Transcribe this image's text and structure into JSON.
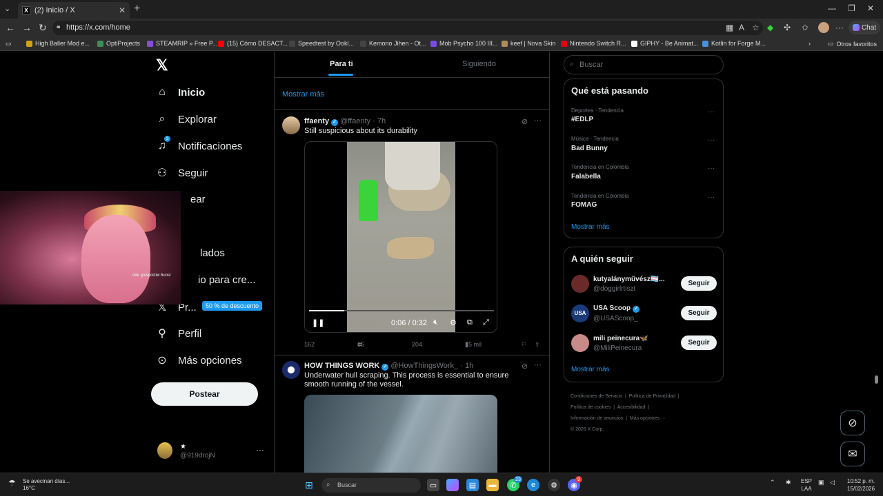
{
  "browser": {
    "tab_title": "(2) Inicio / X",
    "url": "https://x.com/home",
    "copilot_label": "Chat",
    "bookmarks": [
      {
        "label": "High Baller Mod e...",
        "color": "#d4a017"
      },
      {
        "label": "OptiProjects",
        "color": "#3a8f5a"
      },
      {
        "label": "STEAMRIP » Free P...",
        "color": "#8a4cd8"
      },
      {
        "label": "(15) Cómo DESACT...",
        "color": "#ff0000"
      },
      {
        "label": "Speedtest by Ookl...",
        "color": "#444444"
      },
      {
        "label": "Kemono Jihen - Ot...",
        "color": "#444444"
      },
      {
        "label": "Mob Psycho 100 III...",
        "color": "#7a4ce0"
      },
      {
        "label": "keef | Nova Skin",
        "color": "#b08a5a"
      },
      {
        "label": "Nintendo Switch R...",
        "color": "#e60012"
      },
      {
        "label": "GIPHY - Be Animat...",
        "color": "#ffffff"
      },
      {
        "label": "Kotlin for Forge M...",
        "color": "#4a8fd8"
      }
    ],
    "other_favorites": "Otros favoritos"
  },
  "nav": {
    "items": [
      {
        "label": "Inicio",
        "icon": "home-icon"
      },
      {
        "label": "Explorar",
        "icon": "search-icon"
      },
      {
        "label": "Notificaciones",
        "icon": "bell-icon",
        "count": "2"
      },
      {
        "label": "Seguir",
        "icon": "person-add-icon"
      },
      {
        "label": "ear",
        "icon": "chat-icon"
      },
      {
        "label": "lados",
        "icon": "bookmark-icon"
      },
      {
        "label": "io para cre...",
        "icon": "lightning-icon"
      },
      {
        "label": "Pr...",
        "icon": "x-icon"
      },
      {
        "label": "Perfil",
        "icon": "person-icon"
      },
      {
        "label": "Más opciones",
        "icon": "more-circle-icon"
      }
    ],
    "premium_badge": "50 % de descuento",
    "post_button": "Postear",
    "account": {
      "name": "★",
      "handle": "@919drojN"
    }
  },
  "webcam": {
    "tag": "dde gowpoiziw 6uosr"
  },
  "timeline": {
    "tabs": [
      {
        "label": "Para ti",
        "active": true
      },
      {
        "label": "Siguiendo",
        "active": false
      }
    ],
    "show_more": "Mostrar más",
    "tweets": [
      {
        "name": "ffaenty",
        "handle": "@ffaenty",
        "time": "· 7h",
        "text": "Still suspicious about its durability",
        "video": {
          "current": "0:06",
          "total": "0:32",
          "progress": 0.19
        },
        "replies": "162",
        "reposts": "65",
        "likes": "204",
        "views": "75 mil"
      },
      {
        "name": "HOW THINGS WORK",
        "handle": "@HowThingsWork_",
        "time": "· 1h",
        "text": "Underwater hull scraping. This process is essential to ensure smooth running of the vessel."
      }
    ]
  },
  "sidebar": {
    "search_placeholder": "Buscar",
    "trends_title": "Qué está pasando",
    "trends": [
      {
        "meta": "Deportes · Tendencia",
        "name": "#EDLP"
      },
      {
        "meta": "Música · Tendencia",
        "name": "Bad Bunny"
      },
      {
        "meta": "Tendencia en Colombia",
        "name": "Falabella"
      },
      {
        "meta": "Tendencia en Colombia",
        "name": "FOMAG"
      }
    ],
    "show_more": "Mostrar más",
    "who_title": "A quién seguir",
    "who": [
      {
        "name": "kutyalányművész🏳️‍⚧️...",
        "handle": "@doggirlrtiszt",
        "color": "#6b2a2a"
      },
      {
        "name": "USA Scoop",
        "handle": "@USAScoop_",
        "color": "#1a3a7a",
        "verified": true
      },
      {
        "name": "mili peinecura🦋",
        "handle": "@MiliPeinecura",
        "color": "#c98a8a"
      }
    ],
    "follow_label": "Seguir",
    "footer": [
      "Condiciones de Servicio",
      "Política de Privacidad",
      "Política de cookies",
      "Accesibilidad",
      "Información de anuncios",
      "Más opciones ···",
      "© 2026 X Corp."
    ]
  },
  "taskbar": {
    "weather_text": "Se avecinan días...",
    "weather_temp": "16°C",
    "search": "Buscar",
    "whatsapp_count": "23",
    "discord_count": "9",
    "lang1": "ESP",
    "lang2": "LAA",
    "time": "10:52 p. m.",
    "date": "15/02/2026"
  }
}
